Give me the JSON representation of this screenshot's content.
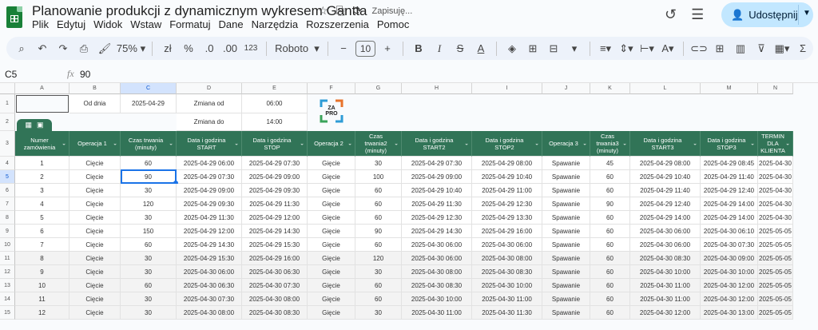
{
  "app": {
    "title": "Planowanie produkcji z dynamicznym wykresem Gantta",
    "saving": "Zapisuję...",
    "share_label": "Udostępnij"
  },
  "menu": [
    "Plik",
    "Edytuj",
    "Widok",
    "Wstaw",
    "Formatuj",
    "Dane",
    "Narzędzia",
    "Rozszerzenia",
    "Pomoc"
  ],
  "toolbar": {
    "zoom": "75%",
    "currency": "zł",
    "percent": "%",
    "dec_less": ".0",
    "dec_more": ".00",
    "number_format": "123",
    "font": "Roboto",
    "font_size": "10",
    "bold": "B",
    "italic": "I",
    "strike": "S",
    "text_color": "A",
    "sum": "Σ"
  },
  "formula_bar": {
    "cell_ref": "C5",
    "fx": "fx",
    "value": "90"
  },
  "columns": [
    "A",
    "B",
    "C",
    "D",
    "E",
    "F",
    "G",
    "H",
    "I",
    "J",
    "K",
    "L",
    "M",
    "N"
  ],
  "top_rows": {
    "row1": {
      "num": "1",
      "b": "Od dnia",
      "c": "2025-04-29",
      "d": "Zmiana od",
      "e": "06:00"
    },
    "row2": {
      "num": "2",
      "d": "Zmiana do",
      "e": "14:00"
    }
  },
  "logo_text": "ZA\nPRO",
  "headers": [
    "Numer zamówienia",
    "Operacja 1",
    "Czas trwania (minuty)",
    "Data i godzina START",
    "Data i godzina STOP",
    "Operacja 2",
    "Czas trwania2 (minuty)",
    "Data i godzina START2",
    "Data i godzina STOP2",
    "Operacja 3",
    "Czas trwania3 (minuty)",
    "Data i godzina START3",
    "Data i godzina STOP3",
    "TERMIN DLA KLIENTA"
  ],
  "rows": [
    {
      "n": "4",
      "cells": [
        "1",
        "Cięcie",
        "60",
        "2025-04-29 06:00",
        "2025-04-29 07:30",
        "Gięcie",
        "30",
        "2025-04-29 07:30",
        "2025-04-29 08:00",
        "Spawanie",
        "45",
        "2025-04-29 08:00",
        "2025-04-29 08:45",
        "2025-04-30"
      ]
    },
    {
      "n": "5",
      "cells": [
        "2",
        "Cięcie",
        "90",
        "2025-04-29 07:30",
        "2025-04-29 09:00",
        "Gięcie",
        "100",
        "2025-04-29 09:00",
        "2025-04-29 10:40",
        "Spawanie",
        "60",
        "2025-04-29 10:40",
        "2025-04-29 11:40",
        "2025-04-30"
      ]
    },
    {
      "n": "6",
      "cells": [
        "3",
        "Cięcie",
        "30",
        "2025-04-29 09:00",
        "2025-04-29 09:30",
        "Gięcie",
        "60",
        "2025-04-29 10:40",
        "2025-04-29 11:00",
        "Spawanie",
        "60",
        "2025-04-29 11:40",
        "2025-04-29 12:40",
        "2025-04-30"
      ]
    },
    {
      "n": "7",
      "cells": [
        "4",
        "Cięcie",
        "120",
        "2025-04-29 09:30",
        "2025-04-29 11:30",
        "Gięcie",
        "60",
        "2025-04-29 11:30",
        "2025-04-29 12:30",
        "Spawanie",
        "90",
        "2025-04-29 12:40",
        "2025-04-29 14:00",
        "2025-04-30"
      ]
    },
    {
      "n": "8",
      "cells": [
        "5",
        "Cięcie",
        "30",
        "2025-04-29 11:30",
        "2025-04-29 12:00",
        "Gięcie",
        "60",
        "2025-04-29 12:30",
        "2025-04-29 13:30",
        "Spawanie",
        "60",
        "2025-04-29 14:00",
        "2025-04-29 14:00",
        "2025-04-30"
      ]
    },
    {
      "n": "9",
      "cells": [
        "6",
        "Cięcie",
        "150",
        "2025-04-29 12:00",
        "2025-04-29 14:30",
        "Gięcie",
        "90",
        "2025-04-29 14:30",
        "2025-04-29 16:00",
        "Spawanie",
        "60",
        "2025-04-30 06:00",
        "2025-04-30 06:10",
        "2025-05-05"
      ]
    },
    {
      "n": "10",
      "cells": [
        "7",
        "Cięcie",
        "60",
        "2025-04-29 14:30",
        "2025-04-29 15:30",
        "Gięcie",
        "60",
        "2025-04-30 06:00",
        "2025-04-30 06:00",
        "Spawanie",
        "60",
        "2025-04-30 06:00",
        "2025-04-30 07:30",
        "2025-05-05"
      ]
    },
    {
      "n": "11",
      "cells": [
        "8",
        "Cięcie",
        "30",
        "2025-04-29 15:30",
        "2025-04-29 16:00",
        "Gięcie",
        "120",
        "2025-04-30 06:00",
        "2025-04-30 08:00",
        "Spawanie",
        "60",
        "2025-04-30 08:30",
        "2025-04-30 09:00",
        "2025-05-05"
      ]
    },
    {
      "n": "12",
      "cells": [
        "9",
        "Cięcie",
        "30",
        "2025-04-30 06:00",
        "2025-04-30 06:30",
        "Gięcie",
        "30",
        "2025-04-30 08:00",
        "2025-04-30 08:30",
        "Spawanie",
        "60",
        "2025-04-30 10:00",
        "2025-04-30 10:00",
        "2025-05-05"
      ]
    },
    {
      "n": "13",
      "cells": [
        "10",
        "Cięcie",
        "60",
        "2025-04-30 06:30",
        "2025-04-30 07:30",
        "Gięcie",
        "60",
        "2025-04-30 08:30",
        "2025-04-30 10:00",
        "Spawanie",
        "60",
        "2025-04-30 11:00",
        "2025-04-30 12:00",
        "2025-05-05"
      ]
    },
    {
      "n": "14",
      "cells": [
        "11",
        "Cięcie",
        "30",
        "2025-04-30 07:30",
        "2025-04-30 08:00",
        "Gięcie",
        "60",
        "2025-04-30 10:00",
        "2025-04-30 11:00",
        "Spawanie",
        "60",
        "2025-04-30 11:00",
        "2025-04-30 12:00",
        "2025-05-05"
      ]
    },
    {
      "n": "15",
      "cells": [
        "12",
        "Cięcie",
        "30",
        "2025-04-30 08:00",
        "2025-04-30 08:30",
        "Gięcie",
        "30",
        "2025-04-30 11:00",
        "2025-04-30 11:30",
        "Spawanie",
        "60",
        "2025-04-30 12:00",
        "2025-04-30 13:00",
        "2025-05-05"
      ]
    }
  ],
  "colors": {
    "header_green": "#317457",
    "share_bg": "#c2e7ff",
    "selection": "#1a73e8",
    "sheets_green": "#188038"
  }
}
